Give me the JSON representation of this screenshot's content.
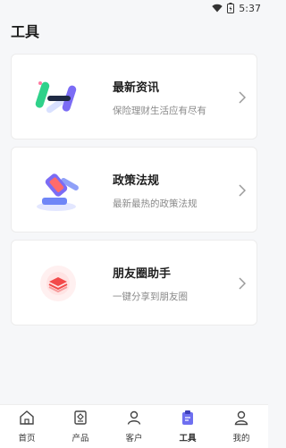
{
  "status": {
    "time": "5:37"
  },
  "header": {
    "title": "工具"
  },
  "cards": [
    {
      "title": "最新资讯",
      "subtitle": "保险理财生活应有尽有",
      "icon": "news-icon"
    },
    {
      "title": "政策法规",
      "subtitle": "最新最热的政策法规",
      "icon": "gavel-icon"
    },
    {
      "title": "朋友圈助手",
      "subtitle": "一键分享到朋友圈",
      "icon": "stack-icon"
    }
  ],
  "tabs": [
    {
      "label": "首页",
      "icon": "home-icon"
    },
    {
      "label": "产品",
      "icon": "product-icon"
    },
    {
      "label": "客户",
      "icon": "customer-icon"
    },
    {
      "label": "工具",
      "icon": "clipboard-icon",
      "active": true
    },
    {
      "label": "我的",
      "icon": "profile-icon"
    }
  ],
  "colors": {
    "accent_green": "#2fd18a",
    "accent_purple": "#7b6cf5",
    "accent_blue": "#6f86f7",
    "accent_red": "#f24a4a"
  }
}
